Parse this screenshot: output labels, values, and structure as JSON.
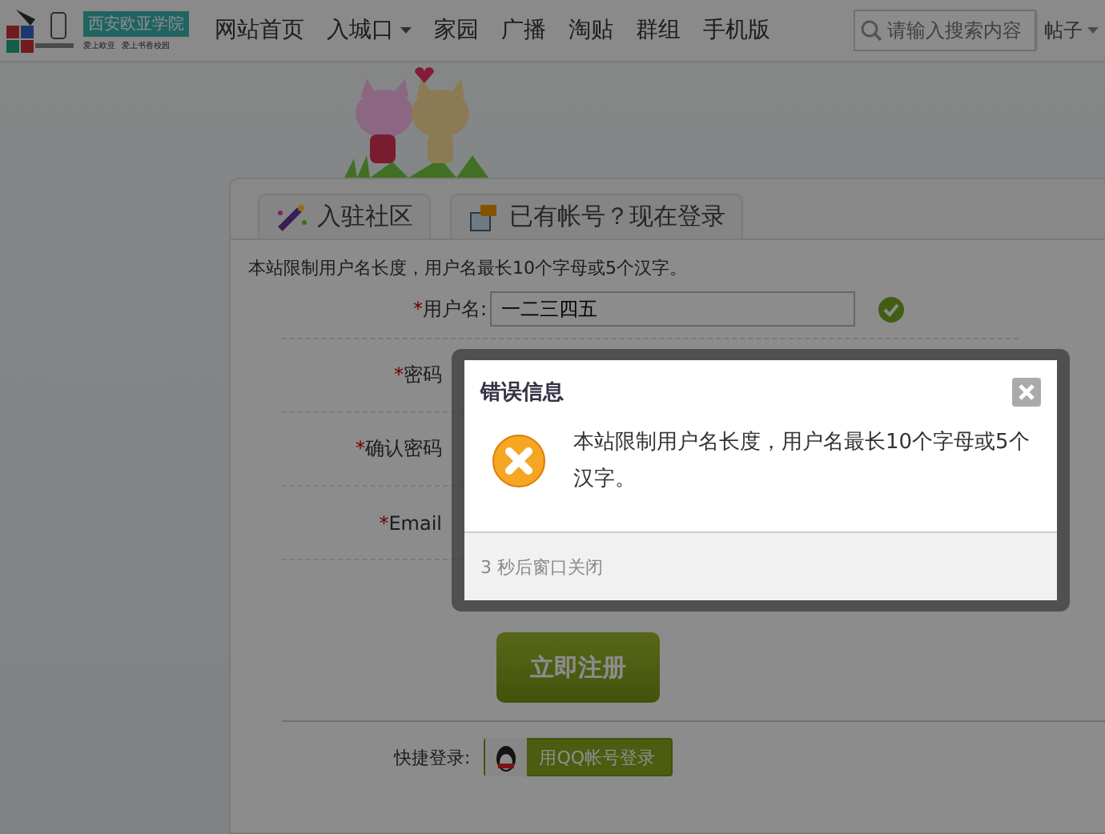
{
  "header": {
    "logo_title": "西安欧亚学院",
    "logo_sub": [
      "爱上欧亚",
      "爱上书香校园"
    ],
    "nav": [
      {
        "label": "网站首页",
        "dropdown": false
      },
      {
        "label": "入城口",
        "dropdown": true
      },
      {
        "label": "家园",
        "dropdown": false
      },
      {
        "label": "广播",
        "dropdown": false
      },
      {
        "label": "淘贴",
        "dropdown": false
      },
      {
        "label": "群组",
        "dropdown": false
      },
      {
        "label": "手机版",
        "dropdown": false
      }
    ],
    "search": {
      "placeholder": "请输入搜索内容",
      "scope": "帖子"
    }
  },
  "tabs": [
    {
      "label": "入驻社区",
      "selected": false
    },
    {
      "label": "已有帐号？现在登录",
      "selected": false
    }
  ],
  "notice": "本站限制用户名长度，用户名最长10个字母或5个汉字。",
  "fields": [
    {
      "mark": "*",
      "label": "用户名:",
      "value": "一二三四五",
      "valid": true
    },
    {
      "mark": "*",
      "label": "密码"
    },
    {
      "mark": "*",
      "label": "确认密码"
    },
    {
      "mark": "*",
      "label": "Email"
    }
  ],
  "submit": "立即注册",
  "quick_login": {
    "label": "快捷登录:",
    "button": "用QQ帐号登录"
  },
  "dialog": {
    "title": "错误信息",
    "message": "本站限制用户名长度，用户名最长10个字母或5个汉字。",
    "footer": "3 秒后窗口关闭"
  }
}
